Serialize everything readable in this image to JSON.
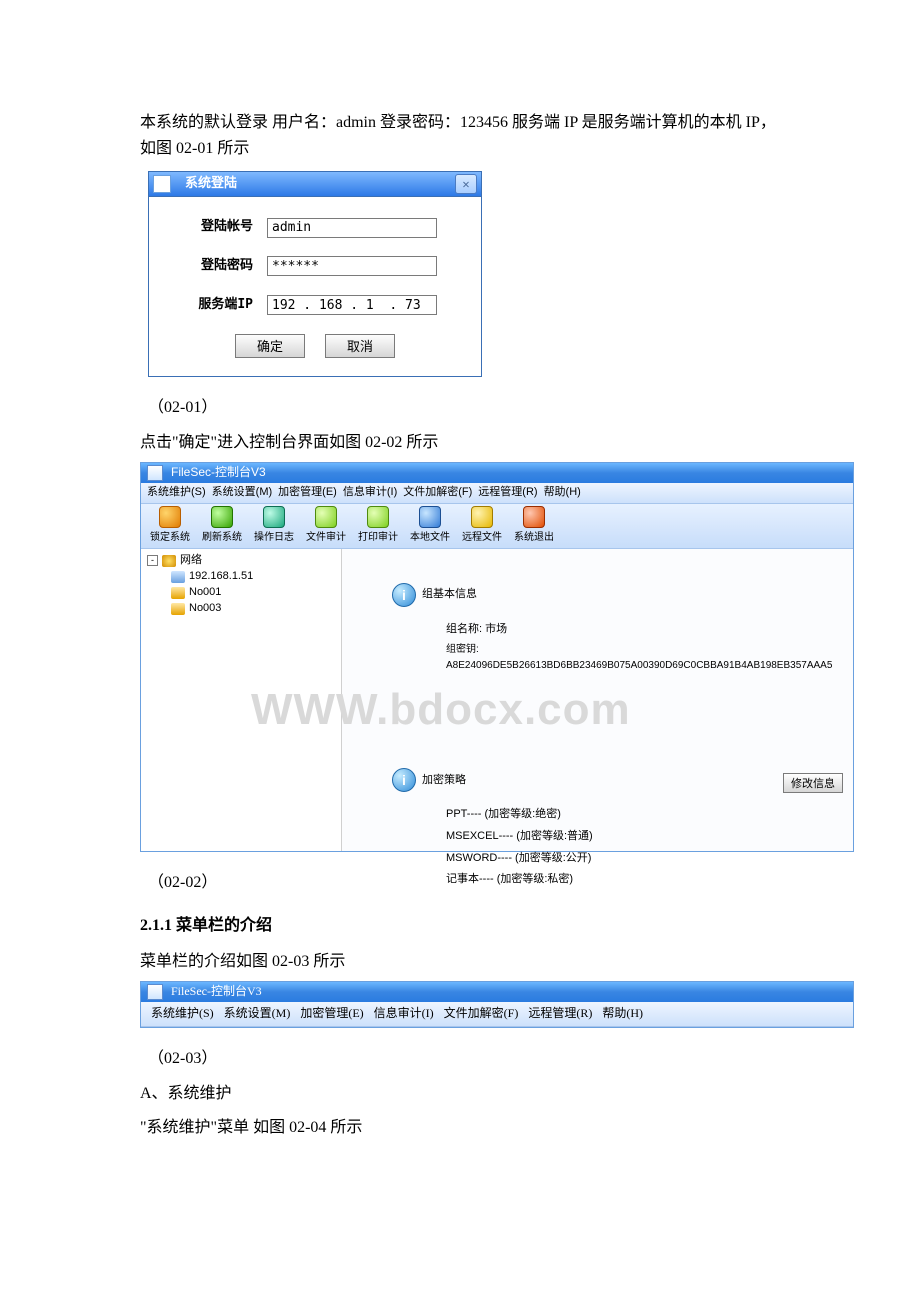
{
  "intro_para": "本系统的默认登录 用户名：admin 登录密码：123456 服务端 IP 是服务端计算机的本机 IP，如图 02-01 所示",
  "login": {
    "title": "系统登陆",
    "account_label": "登陆帐号",
    "password_label": "登陆密码",
    "server_label": "服务端IP",
    "account_value": "admin",
    "password_value": "******",
    "server_value": "192 . 168 . 1  . 73",
    "ok": "确定",
    "cancel": "取消"
  },
  "caption_0201": "（02-01）",
  "after_0201": "点击\"确定\"进入控制台界面如图 02-02 所示",
  "console": {
    "title": "FileSec-控制台V3",
    "menu": [
      "系统维护(S)",
      "系统设置(M)",
      "加密管理(E)",
      "信息审计(I)",
      "文件加解密(F)",
      "远程管理(R)",
      "帮助(H)"
    ],
    "toolbar": [
      "锁定系统",
      "刷新系统",
      "操作日志",
      "文件审计",
      "打印审计",
      "本地文件",
      "远程文件",
      "系统退出"
    ],
    "tree": {
      "root": "网络",
      "items": [
        "192.168.1.51",
        "No001",
        "No003"
      ]
    },
    "group_info_title": "组基本信息",
    "group_name_label": "组名称:",
    "group_name_value": "市场",
    "group_key_label": "组密钥:",
    "group_key_value": "A8E24096DE5B26613BD6BB23469B075A00390D69C0CBBA91B4AB198EB357AAA5",
    "policy_title": "加密策略",
    "policy_lines": [
      "PPT---- (加密等级:绝密)",
      "MSEXCEL---- (加密等级:普通)",
      "MSWORD---- (加密等级:公开)",
      "记事本---- (加密等级:私密)"
    ],
    "edit_btn": "修改信息"
  },
  "watermark": "WWW.bdocx.com",
  "caption_0202": "（02-02）",
  "section_211": "2.1.1 菜单栏的介绍",
  "section_211_text": "菜单栏的介绍如图 02-03 所示",
  "caption_0203": "（02-03）",
  "item_a": "A、系统维护",
  "item_a_text": "\"系统维护\"菜单 如图 02-04 所示"
}
